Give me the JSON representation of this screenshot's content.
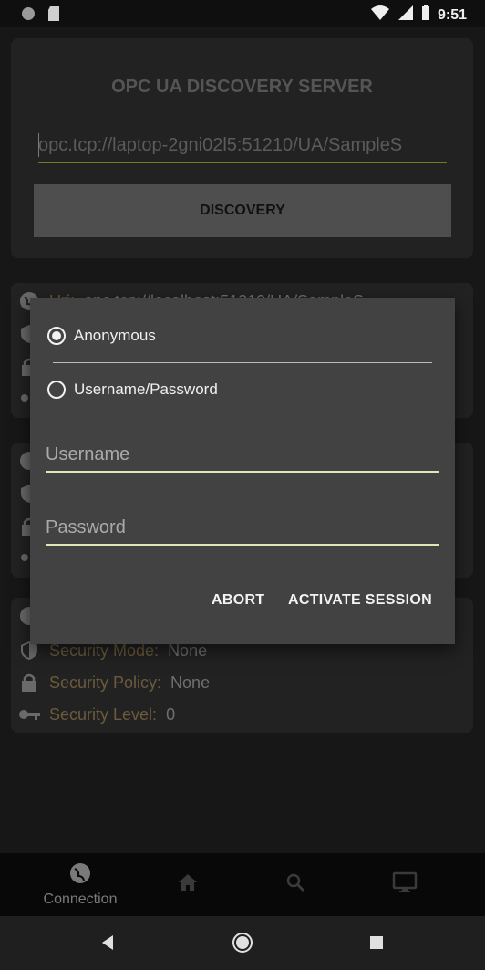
{
  "status_bar": {
    "time": "9:51",
    "icons": [
      "circle-icon",
      "sd-card-icon",
      "wifi-icon",
      "signal-icon",
      "battery-icon"
    ]
  },
  "server": {
    "title": "OPC UA DISCOVERY SERVER",
    "endpoint_url": "opc.tcp://laptop-2gni02l5:51210/UA/SampleS",
    "discovery_label": "DISCOVERY"
  },
  "endpoints": [
    {
      "url_prefix": "Uri:",
      "url": "opc.tcp://localhost:51210/UA/SampleS"
    },
    {},
    {
      "security_mode_label": "Security Mode:",
      "security_mode": "None",
      "security_policy_label": "Security Policy:",
      "security_policy": "None",
      "security_level_label": "Security Level:",
      "security_level": "0"
    }
  ],
  "dialog": {
    "option_anonymous": "Anonymous",
    "option_userpass": "Username/Password",
    "selected": "Anonymous",
    "username_placeholder": "Username",
    "password_placeholder": "Password",
    "abort_label": "ABORT",
    "activate_label": "ACTIVATE SESSION"
  },
  "bottom_nav": {
    "items": [
      {
        "label": "Connection",
        "icon": "globe-icon",
        "active": true
      },
      {
        "label": "",
        "icon": "home-icon"
      },
      {
        "label": "",
        "icon": "search-icon"
      },
      {
        "label": "",
        "icon": "monitor-icon"
      }
    ]
  },
  "colors": {
    "accent_underline": "#e2e6b4",
    "label_brown": "#6c5a3d",
    "dialog_bg": "#424242"
  }
}
